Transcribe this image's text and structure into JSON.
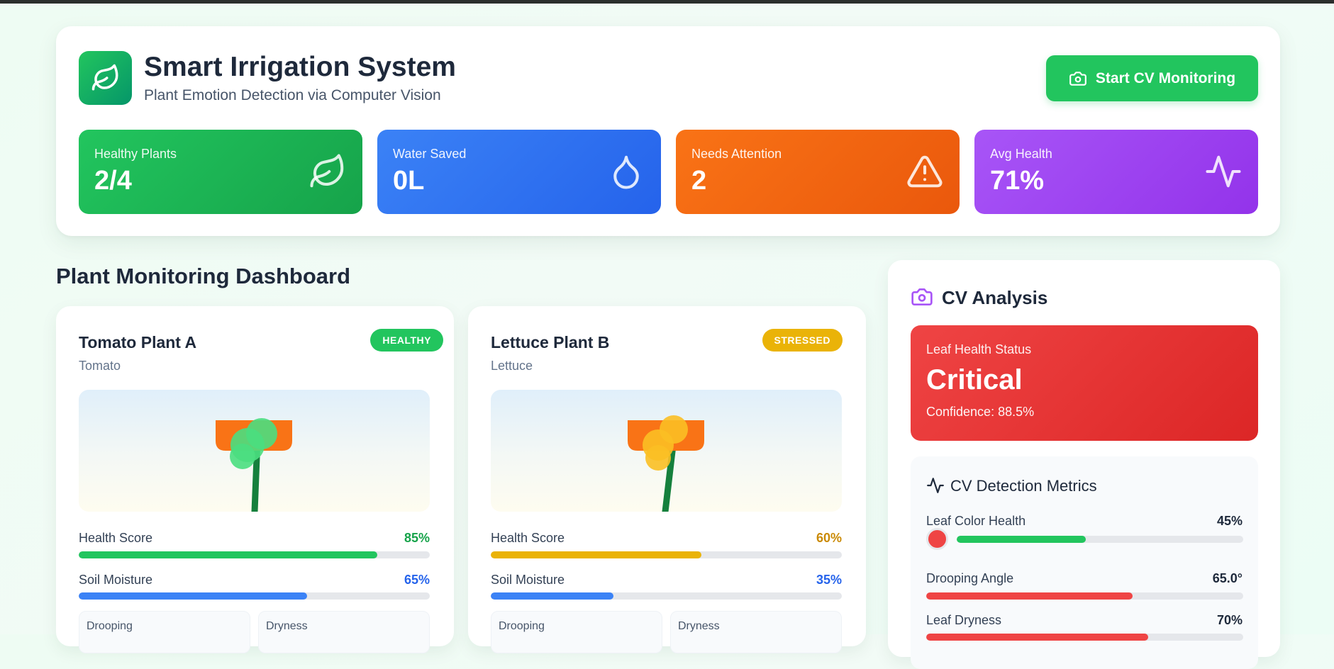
{
  "header": {
    "title": "Smart Irrigation System",
    "subtitle": "Plant Emotion Detection via Computer Vision",
    "start_button": "Start CV Monitoring"
  },
  "stats": [
    {
      "label": "Healthy Plants",
      "value": "2/4",
      "icon": "leaf-icon"
    },
    {
      "label": "Water Saved",
      "value": "0L",
      "icon": "droplet-icon"
    },
    {
      "label": "Needs Attention",
      "value": "2",
      "icon": "warning-icon"
    },
    {
      "label": "Avg Health",
      "value": "71%",
      "icon": "activity-icon"
    }
  ],
  "dashboard": {
    "title": "Plant Monitoring Dashboard",
    "plants": [
      {
        "name": "Tomato Plant A",
        "type": "Tomato",
        "status": "HEALTHY",
        "status_color": "#22c55e",
        "health_label": "Health Score",
        "health": "85%",
        "health_fraction": 0.85,
        "health_color": "#22c55e",
        "health_text_color": "#16a34a",
        "moisture_label": "Soil Moisture",
        "moisture": "65%",
        "moisture_fraction": 0.65,
        "leaf_color": "#4ade80",
        "mini": [
          "Drooping",
          "Dryness"
        ]
      },
      {
        "name": "Lettuce Plant B",
        "type": "Lettuce",
        "status": "STRESSED",
        "status_color": "#eab308",
        "health_label": "Health Score",
        "health": "60%",
        "health_fraction": 0.6,
        "health_color": "#eab308",
        "health_text_color": "#ca8a04",
        "moisture_label": "Soil Moisture",
        "moisture": "35%",
        "moisture_fraction": 0.35,
        "leaf_color": "#fbbf24",
        "mini": [
          "Drooping",
          "Dryness"
        ]
      }
    ]
  },
  "cv": {
    "title": "CV Analysis",
    "status_label": "Leaf Health Status",
    "status_value": "Critical",
    "confidence": "Confidence: 88.5%",
    "metrics_title": "CV Detection Metrics",
    "metrics": [
      {
        "label": "Leaf Color Health",
        "value": "45%",
        "fraction": 0.45,
        "color": "#22c55e"
      },
      {
        "label": "Drooping Angle",
        "value": "65.0°",
        "fraction": 0.65,
        "color": "#ef4444"
      },
      {
        "label": "Leaf Dryness",
        "value": "70%",
        "fraction": 0.7,
        "color": "#ef4444"
      }
    ]
  },
  "colors": {
    "primary": "#22c55e",
    "blue": "#3b82f6",
    "orange": "#f97316",
    "purple": "#a855f7",
    "critical": "#ef4444"
  }
}
